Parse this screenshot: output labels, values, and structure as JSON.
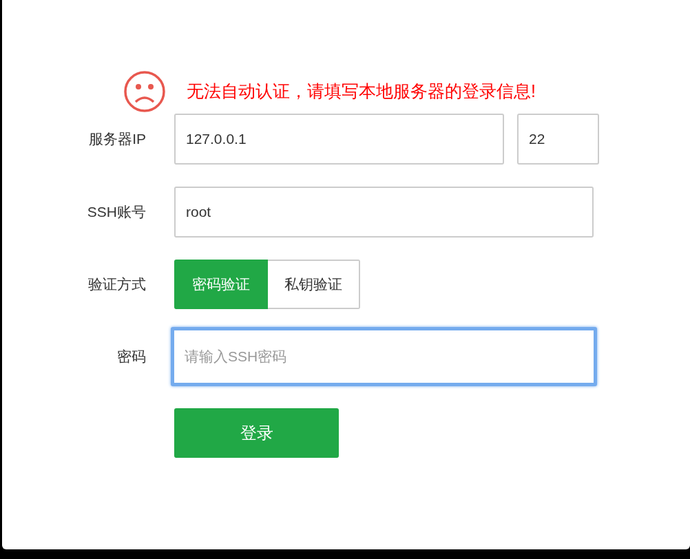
{
  "alert": {
    "message": "无法自动认证，请填写本地服务器的登录信息!"
  },
  "form": {
    "server_ip": {
      "label": "服务器IP",
      "value": "127.0.0.1",
      "port": "22"
    },
    "ssh_account": {
      "label": "SSH账号",
      "value": "root"
    },
    "auth_method": {
      "label": "验证方式",
      "options": [
        {
          "label": "密码验证",
          "selected": true
        },
        {
          "label": "私钥验证",
          "selected": false
        }
      ]
    },
    "password": {
      "label": "密码",
      "placeholder": "请输入SSH密码",
      "focused": true
    },
    "submit": {
      "label": "登录"
    }
  }
}
